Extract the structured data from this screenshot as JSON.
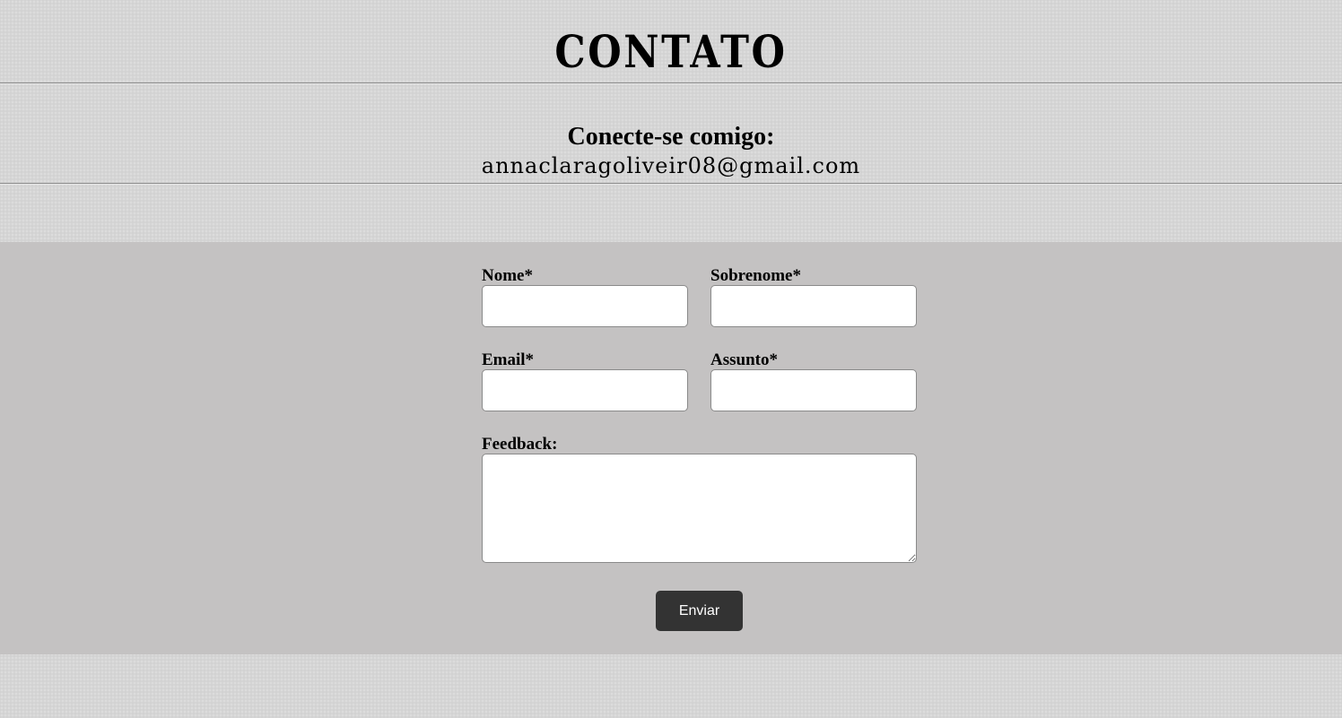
{
  "header": {
    "title": "CONTATO"
  },
  "connect": {
    "heading": "Conecte-se comigo:",
    "email": "annaclaragoliveir08@gmail.com"
  },
  "form": {
    "first_name_label": "Nome*",
    "first_name_value": "",
    "last_name_label": "Sobrenome*",
    "last_name_value": "",
    "email_label": "Email*",
    "email_value": "",
    "subject_label": "Assunto*",
    "subject_value": "",
    "feedback_label": "Feedback:",
    "feedback_value": "",
    "submit_label": "Enviar"
  },
  "colors": {
    "page_background": "#d5d5d5",
    "form_background": "#c4c2c2",
    "button_background": "#333333",
    "button_text": "#ffffff"
  }
}
